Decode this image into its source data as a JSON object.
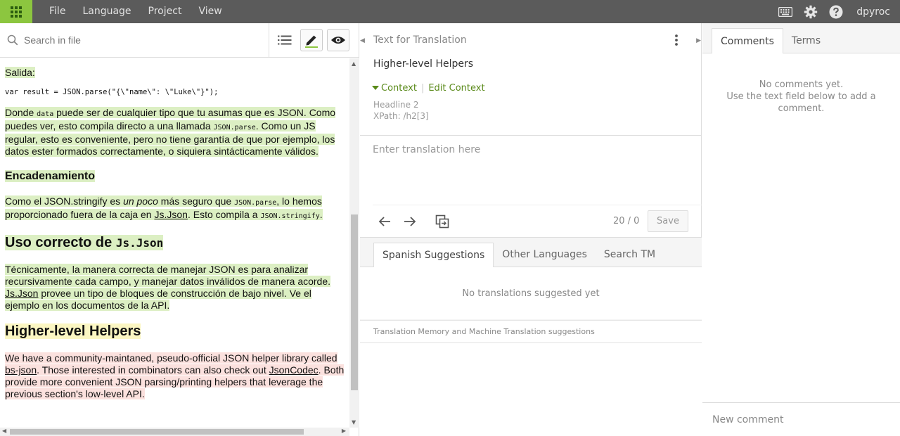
{
  "menu": {
    "items": [
      {
        "label": "File"
      },
      {
        "label": "Language"
      },
      {
        "label": "Project"
      },
      {
        "label": "View"
      }
    ],
    "username": "dpyroc"
  },
  "left": {
    "search_placeholder": "Search in file",
    "doc": {
      "salida": "Salida:",
      "code1": "var result = JSON.parse(\"{\\\"name\\\": \\\"Luke\\\"}\");",
      "p1_a": "Donde ",
      "p1_code1": "data",
      "p1_b": " puede ser de cualquier tipo que tu asumas que es JSON. Como puedes ver, esto compila directo a una llamada ",
      "p1_code2": "JSON.parse",
      "p1_c": ". Como un JS regular, esto es conveniente, pero no tiene garantía de que por ejemplo, los datos ester formados correctamente, o siquiera sintácticamente válidos.",
      "h_encadenamiento": "Encadenamiento",
      "p2_a": "Como el JSON.stringify es ",
      "p2_em": "un poco",
      "p2_b": " más seguro que ",
      "p2_code1": "JSON.parse",
      "p2_c": ", lo hemos proporcionado fuera de la caja en ",
      "p2_link": "Js.Json",
      "p2_d": ". Esto compila a ",
      "p2_code2": "JSON.stringify",
      "p2_e": ".",
      "h_uso_a": "Uso correcto de ",
      "h_uso_code": "Js.Json",
      "p3_a": "Técnicamente, la manera correcta de manejar JSON es para analizar recursivamente cada campo, y manejar datos inválidos de manera acorde. ",
      "p3_link": "Js.Json",
      "p3_b": " provee un tipo de bloques de construcción de bajo nivel. Ve el ejemplo en los documentos de la API.",
      "h_helpers": "Higher-level Helpers",
      "p4_a": "We have a community-maintaned, pseudo-official JSON helper library called ",
      "p4_link1": "bs-json",
      "p4_b": ". Those interested in combinators can also check out ",
      "p4_link2": "JsonCodec",
      "p4_c": ". Both provide more convenient JSON parsing/printing helpers that leverage the previous section's low-level API."
    }
  },
  "middle": {
    "header": "Text for Translation",
    "source_text": "Higher-level Helpers",
    "context_label": "Context",
    "edit_context_label": "Edit Context",
    "ctx_line1": "Headline 2",
    "ctx_line2": "XPath: /h2[3]",
    "translation_placeholder": "Enter translation here",
    "count": "20 / 0",
    "save_label": "Save",
    "tabs": [
      {
        "label": "Spanish Suggestions"
      },
      {
        "label": "Other Languages"
      },
      {
        "label": "Search TM"
      }
    ],
    "no_suggestions": "No translations suggested yet",
    "tm_footer": "Translation Memory and Machine Translation suggestions"
  },
  "right": {
    "tabs": [
      {
        "label": "Comments"
      },
      {
        "label": "Terms"
      }
    ],
    "no_comments_1": "No comments yet.",
    "no_comments_2": "Use the text field below to add a comment.",
    "new_comment_placeholder": "New comment"
  },
  "colors": {
    "accent_green": "#8cc63f",
    "topbar": "#5b5b5b",
    "highlight_translated": "#dcefc3",
    "highlight_current": "#fbf6c2",
    "highlight_untranslated": "#fbe1de"
  }
}
